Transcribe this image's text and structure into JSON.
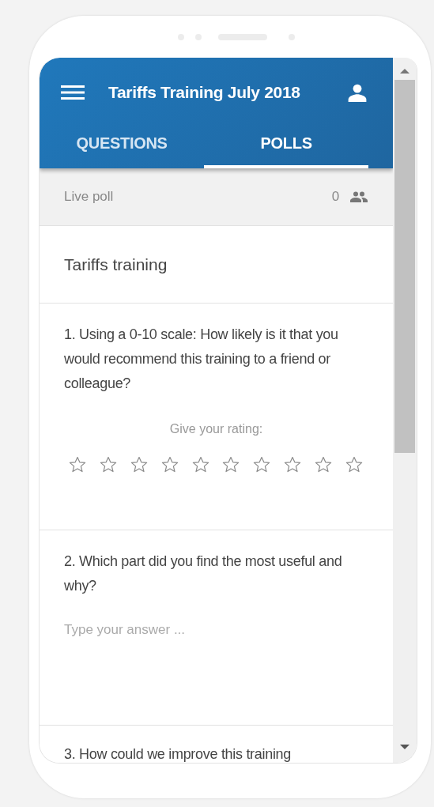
{
  "header": {
    "title": "Tariffs Training July 2018"
  },
  "tabs": [
    {
      "label": "QUESTIONS",
      "selected": false
    },
    {
      "label": "POLLS",
      "selected": true
    }
  ],
  "live_bar": {
    "label": "Live poll",
    "count": "0"
  },
  "poll_title": "Tariffs training",
  "questions": [
    {
      "kind": "rating",
      "text": "1. Using a 0-10 scale: How likely is it that you would recommend this training to a friend or colleague?",
      "prompt": "Give your rating:",
      "stars": 0
    },
    {
      "kind": "text",
      "text": "2. Which part did you find the most useful and why?",
      "placeholder": "Type your answer ..."
    },
    {
      "kind": "text",
      "text": "3. How could we improve this training"
    }
  ]
}
